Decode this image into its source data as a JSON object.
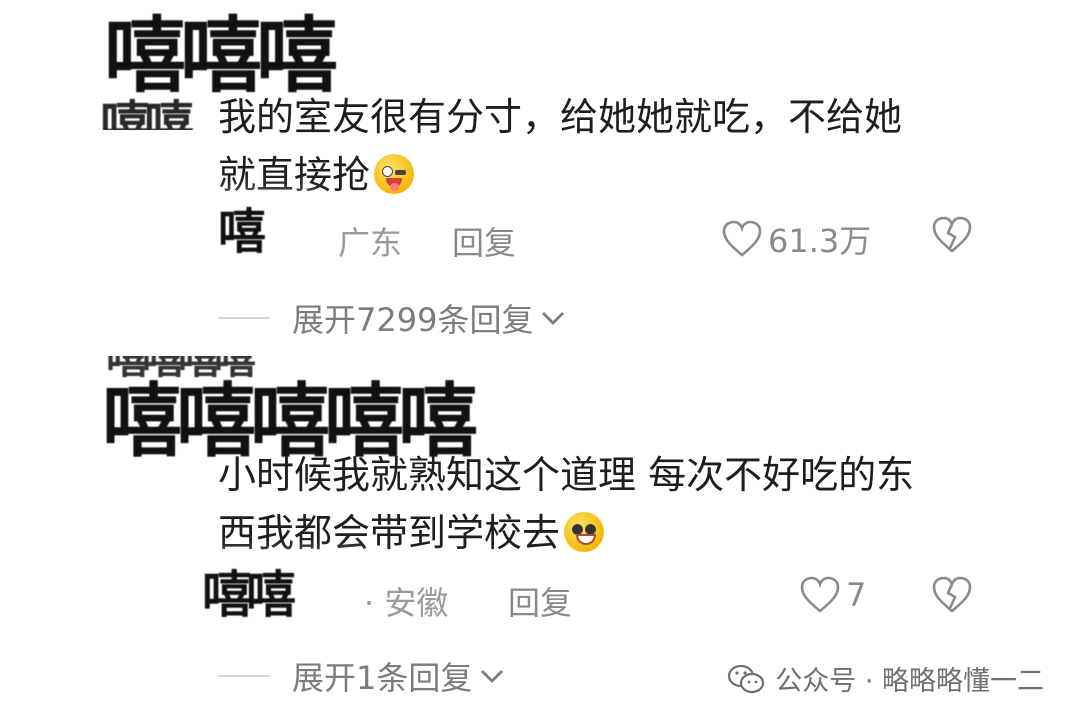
{
  "comments": [
    {
      "username_mosaic": "嘻嘻嘻",
      "username_mosaic_2": "嘻嘻",
      "text_line1": "我的室友很有分寸，给她她就吃，不给她",
      "text_line2": "就直接抢",
      "emoji": "wink-tongue-emoji",
      "time_mosaic": "嘻",
      "location": "广东",
      "reply_label": "回复",
      "like_count": "61.3万",
      "expand_label": "展开7299条回复"
    },
    {
      "username_mosaic": "嘻嘻嘻嘻嘻",
      "username_mosaic_2": "嘻嘻嘻嘻",
      "text_line1": "小时候我就熟知这个道理  每次不好吃的东",
      "text_line2": "西我都会带到学校去",
      "emoji": "grin-emoji",
      "time_mosaic": "嘻嘻",
      "location": "· 安徽",
      "reply_label": "回复",
      "like_count": "7",
      "expand_label": "展开1条回复"
    }
  ],
  "watermark": {
    "text": "公众号 · 略略略懂一二",
    "icon": "wechat-icon"
  },
  "colors": {
    "text": "#1e1e1e",
    "meta": "#9a9a9a",
    "icon": "#8a8a8a"
  }
}
